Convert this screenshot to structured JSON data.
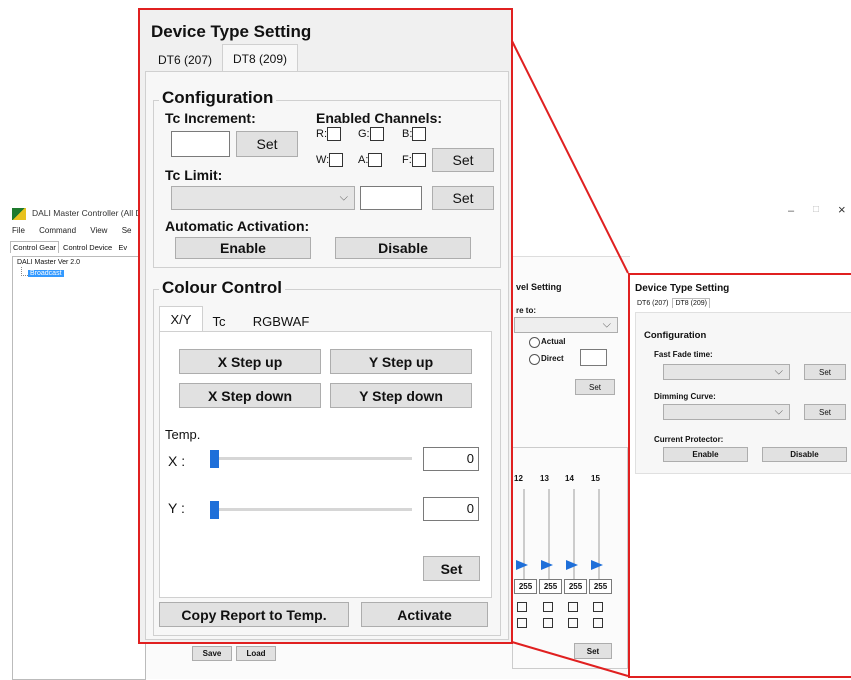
{
  "background_window": {
    "title": "DALI Master Controller (All De",
    "window_controls": {
      "minimize": "–",
      "maximize": "□",
      "close": "×"
    },
    "menu": [
      "File",
      "Command",
      "View",
      "Se"
    ],
    "tabs": [
      "Control Gear",
      "Control Device",
      "Ev"
    ],
    "tree": {
      "root": "DALI Master Ver 2.0",
      "child": "Broadcast"
    },
    "level_setting": {
      "title": "vel Setting",
      "store_label": "re to:",
      "actual_label": "Actual",
      "direct_label": "Direct",
      "set_label": "Set"
    },
    "channels": {
      "headers": [
        "12",
        "13",
        "14",
        "15"
      ],
      "values": [
        "255",
        "255",
        "255",
        "255"
      ],
      "set_label": "Set"
    },
    "save_label": "Save",
    "load_label": "Load"
  },
  "right_panel": {
    "title": "Device Type Setting",
    "tabs": [
      "DT6 (207)",
      "DT8 (209)"
    ],
    "configuration_title": "Configuration",
    "fast_fade_label": "Fast Fade time:",
    "dimming_curve_label": "Dimming Curve:",
    "current_protector_label": "Current Protector:",
    "set_label": "Set",
    "enable_label": "Enable",
    "disable_label": "Disable"
  },
  "zoom_panel": {
    "title": "Device Type Setting",
    "tabs": [
      "DT6 (207)",
      "DT8 (209)"
    ],
    "configuration": {
      "title": "Configuration",
      "tc_increment_label": "Tc Increment:",
      "enabled_channels_label": "Enabled Channels:",
      "channel_labels": [
        "R:",
        "G:",
        "B:",
        "W:",
        "A:",
        "F:"
      ],
      "set_label": "Set",
      "tc_limit_label": "Tc Limit:",
      "automatic_activation_label": "Automatic Activation:",
      "enable_label": "Enable",
      "disable_label": "Disable"
    },
    "colour_control": {
      "title": "Colour Control",
      "tabs": [
        "X/Y",
        "Tc",
        "RGBWAF"
      ],
      "x_step_up": "X Step up",
      "y_step_up": "Y Step up",
      "x_step_down": "X Step down",
      "y_step_down": "Y Step down",
      "temp_label": "Temp.",
      "x_label": "X :",
      "y_label": "Y :",
      "x_value": "0",
      "y_value": "0",
      "x_slider_level": 0,
      "y_slider_level": 0,
      "set_label": "Set"
    },
    "copy_report_label": "Copy Report to Temp.",
    "activate_label": "Activate"
  },
  "colors": {
    "highlight": "#e02020",
    "selection": "#3399ff",
    "slider": "#1e6fd9"
  }
}
